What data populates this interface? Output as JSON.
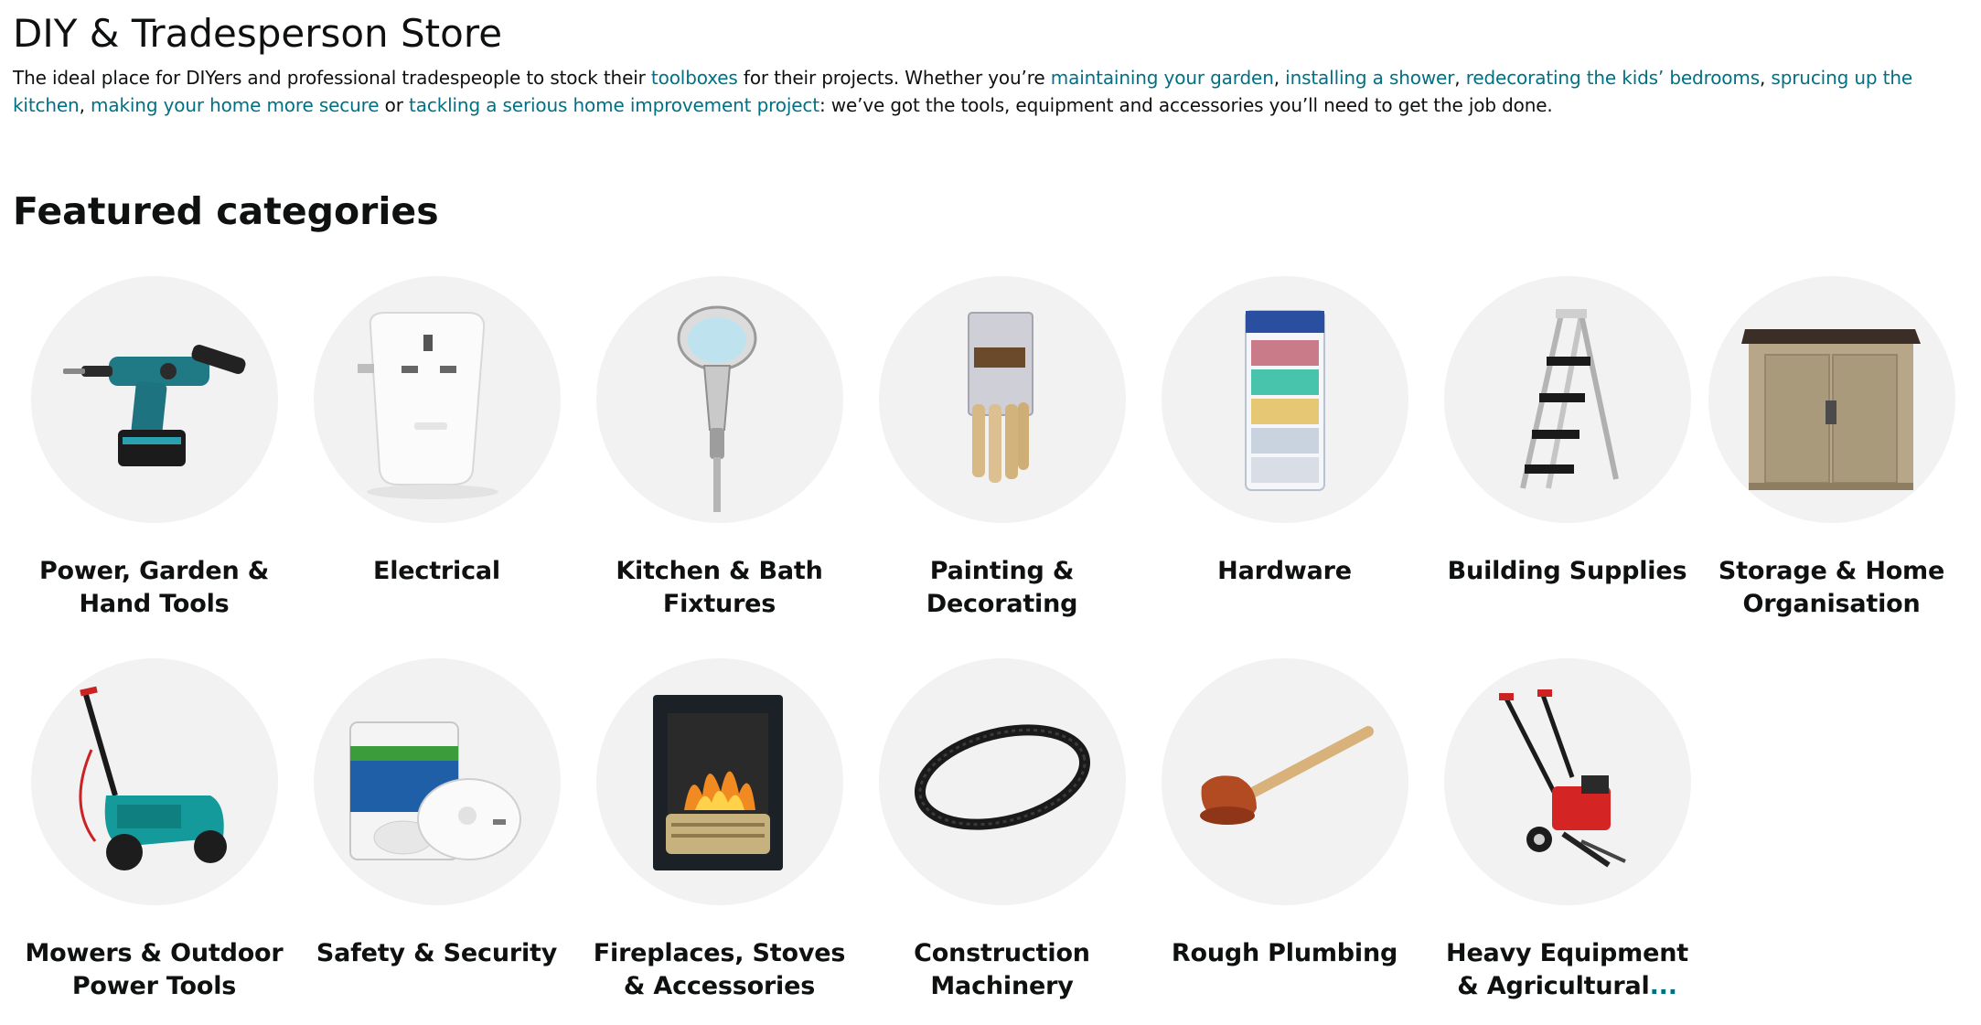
{
  "store": {
    "title": "DIY & Tradesperson Store"
  },
  "intro": {
    "t1": "The ideal place for DIYers and professional tradespeople to stock their ",
    "link_toolboxes": "toolboxes",
    "t2": " for their projects. Whether you’re ",
    "link_garden": "maintaining your garden",
    "t3": ", ",
    "link_shower": "installing a shower",
    "t4": ", ",
    "link_bedrooms": "redecorating the kids’ bedrooms",
    "t5": ", ",
    "link_kitchen": "sprucing up the kitchen",
    "t6": ", ",
    "link_secure": "making your home more secure",
    "t7": " or ",
    "link_project": "tackling a serious home improvement project",
    "t8": ": we’ve got the tools, equipment and accessories you’ll need to get the job done."
  },
  "featured": {
    "heading": "Featured categories",
    "categories": [
      {
        "line1": "Power, Garden &",
        "line2": "Hand Tools",
        "icon": "power-drill-icon"
      },
      {
        "line1": "Electrical",
        "line2": "",
        "icon": "smart-plug-icon"
      },
      {
        "line1": "Kitchen & Bath",
        "line2": "Fixtures",
        "icon": "shower-head-icon"
      },
      {
        "line1": "Painting &",
        "line2": "Decorating",
        "icon": "paint-brushes-icon"
      },
      {
        "line1": "Hardware",
        "line2": "",
        "icon": "screw-assortment-icon"
      },
      {
        "line1": "Building Supplies",
        "line2": "",
        "icon": "step-ladder-icon"
      },
      {
        "line1": "Storage & Home",
        "line2": "Organisation",
        "icon": "storage-shed-icon"
      },
      {
        "line1": "Mowers & Outdoor",
        "line2": "Power Tools",
        "icon": "lawn-mower-icon"
      },
      {
        "line1": "Safety & Security",
        "line2": "",
        "icon": "co-alarm-icon"
      },
      {
        "line1": "Fireplaces, Stoves",
        "line2": "& Accessories",
        "icon": "electric-fire-icon"
      },
      {
        "line1": "Construction",
        "line2": "Machinery",
        "icon": "drive-belt-icon"
      },
      {
        "line1": "Rough Plumbing",
        "line2": "",
        "icon": "plunger-icon"
      },
      {
        "line1": "Heavy Equipment",
        "line2": "& Agricultural",
        "line2_ellipsis": "...",
        "icon": "tiller-icon"
      }
    ]
  },
  "colors": {
    "link": "#007185",
    "text": "#0f1111",
    "circle": "#f2f2f2"
  }
}
